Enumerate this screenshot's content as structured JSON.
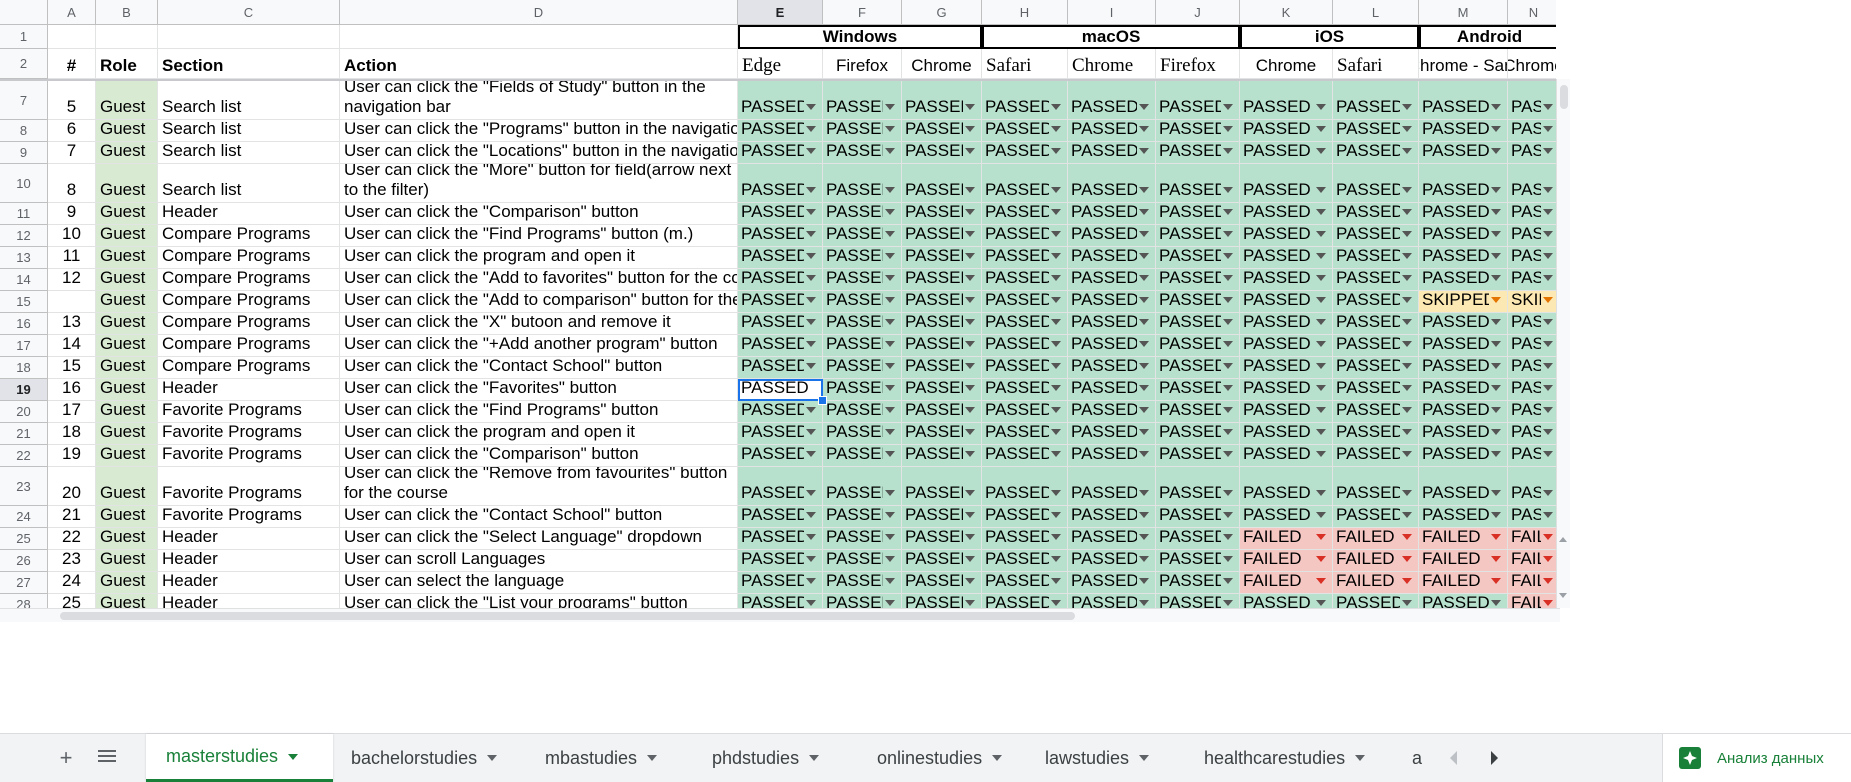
{
  "columns": [
    "A",
    "B",
    "C",
    "D",
    "E",
    "F",
    "G",
    "H",
    "I",
    "J",
    "K",
    "L",
    "M",
    "N"
  ],
  "selected_column": "E",
  "groups": [
    {
      "label": "Windows",
      "startCol": 4,
      "endCol": 6
    },
    {
      "label": "macOS",
      "startCol": 7,
      "endCol": 9
    },
    {
      "label": "iOS",
      "startCol": 10,
      "endCol": 11
    },
    {
      "label": "Android",
      "startCol": 12,
      "endCol": 13
    }
  ],
  "header": {
    "row1_number": "1",
    "row2_number": "2",
    "cells": [
      "#",
      "Role",
      "Section",
      "Action",
      "Edge",
      "Firefox",
      "Chrome",
      "Safari",
      "Chrome",
      "Firefox",
      "Chrome",
      "Safari",
      "Chrome - Sam",
      "Chrome"
    ]
  },
  "rows": [
    {
      "rn": "7",
      "num": "5",
      "role": "Guest",
      "section": "Search list",
      "action": "User can click the \"Fields of Study\" button in the navigation bar",
      "st": "PPPPPPPPPP"
    },
    {
      "rn": "8",
      "num": "6",
      "role": "Guest",
      "section": "Search list",
      "action": "User can click the \"Programs\" button in the navigation bar",
      "st": "PPPPPPPPPP"
    },
    {
      "rn": "9",
      "num": "7",
      "role": "Guest",
      "section": "Search list",
      "action": "User can click the \"Locations\" button in the navigation bar",
      "st": "PPPPPPPPPP"
    },
    {
      "rn": "10",
      "num": "8",
      "role": "Guest",
      "section": "Search list",
      "action": "User can click the \"More\" button for field(arrow next to the filter)",
      "st": "PPPPPPPPPP"
    },
    {
      "rn": "11",
      "num": "9",
      "role": "Guest",
      "section": "Header",
      "action": "User can click the \"Comparison\" button",
      "st": "PPPPPPPPPP"
    },
    {
      "rn": "12",
      "num": "10",
      "role": "Guest",
      "section": "Compare Programs",
      "action": "User can click the \"Find Programs\" button (m.)",
      "st": "PPPPPPPPPP"
    },
    {
      "rn": "13",
      "num": "11",
      "role": "Guest",
      "section": "Compare Programs",
      "action": "User can click the program and open it",
      "st": "PPPPPPPPPP"
    },
    {
      "rn": "14",
      "num": "12",
      "role": "Guest",
      "section": "Compare Programs",
      "action": "User can click the \"Add to favorites\" button for the course",
      "st": "PPPPPPPPPP"
    },
    {
      "rn": "15",
      "num": "",
      "role": "Guest",
      "section": "Compare Programs",
      "action": "User can click the \"Add to comparison\" button for the course",
      "st": "PPPPPPPPSS"
    },
    {
      "rn": "16",
      "num": "13",
      "role": "Guest",
      "section": "Compare Programs",
      "action": "User can click the \"X\" butoon and remove it",
      "st": "PPPPPPPPPP"
    },
    {
      "rn": "17",
      "num": "14",
      "role": "Guest",
      "section": "Compare Programs",
      "action": "User can click the \"+Add another program\" button",
      "st": "PPPPPPPPPP"
    },
    {
      "rn": "18",
      "num": "15",
      "role": "Guest",
      "section": "Compare Programs",
      "action": "User can click the \"Contact School\" button",
      "st": "PPPPPPPPPP"
    },
    {
      "rn": "19",
      "num": "16",
      "role": "Guest",
      "section": "Header",
      "action": "User can click the \"Favorites\" button",
      "st": "PPPPPPPPPP"
    },
    {
      "rn": "20",
      "num": "17",
      "role": "Guest",
      "section": "Favorite Programs",
      "action": "User can click the \"Find Programs\" button",
      "st": "PPPPPPPPPP"
    },
    {
      "rn": "21",
      "num": "18",
      "role": "Guest",
      "section": "Favorite Programs",
      "action": "User can click the program and open it",
      "st": "PPPPPPPPPP"
    },
    {
      "rn": "22",
      "num": "19",
      "role": "Guest",
      "section": "Favorite Programs",
      "action": "User can click the \"Comparison\" button",
      "st": "PPPPPPPPPP"
    },
    {
      "rn": "23",
      "num": "20",
      "role": "Guest",
      "section": "Favorite Programs",
      "action": "User can click the \"Remove from favourites\" button for the course",
      "st": "PPPPPPPPPP"
    },
    {
      "rn": "24",
      "num": "21",
      "role": "Guest",
      "section": "Favorite Programs",
      "action": "User can click the \"Contact School\" button",
      "st": "PPPPPPPPPP"
    },
    {
      "rn": "25",
      "num": "22",
      "role": "Guest",
      "section": "Header",
      "action": "User can click the \"Select Language\" dropdown",
      "st": "PPPPPPFFFF"
    },
    {
      "rn": "26",
      "num": "23",
      "role": "Guest",
      "section": "Header",
      "action": "User can scroll Languages",
      "st": "PPPPPPFFFF"
    },
    {
      "rn": "27",
      "num": "24",
      "role": "Guest",
      "section": "Header",
      "action": "User can select the language",
      "st": "PPPPPPFFFF"
    },
    {
      "rn": "28",
      "num": "25",
      "role": "Guest",
      "section": "Header",
      "action": "User can click the \"List your programs\" button",
      "st": "PPPPPPPPPF"
    }
  ],
  "status_labels": {
    "P": "PASSED",
    "F": "FAILED",
    "S": "SKIPPED"
  },
  "selected_cell": {
    "row": "19",
    "col": "E"
  },
  "colors": {
    "passed": "#b7e1cd",
    "failed": "#f4c7c3",
    "skipped": "#fce8b2",
    "role_fill": "#d9ead3",
    "accent": "#188038",
    "selection": "#1a73e8"
  },
  "tabs": [
    {
      "label": "masterstudies",
      "active": true
    },
    {
      "label": "bachelorstudies",
      "active": false
    },
    {
      "label": "mbastudies",
      "active": false
    },
    {
      "label": "phdstudies",
      "active": false
    },
    {
      "label": "onlinestudies",
      "active": false
    },
    {
      "label": "lawstudies",
      "active": false
    },
    {
      "label": "healthcarestudies",
      "active": false
    },
    {
      "label": "a",
      "active": false
    }
  ],
  "tabbar": {
    "add_icon": "plus-icon",
    "list_icon": "menu-list-icon",
    "explore_label": "Анализ данных",
    "explore_icon": "explore-icon"
  }
}
